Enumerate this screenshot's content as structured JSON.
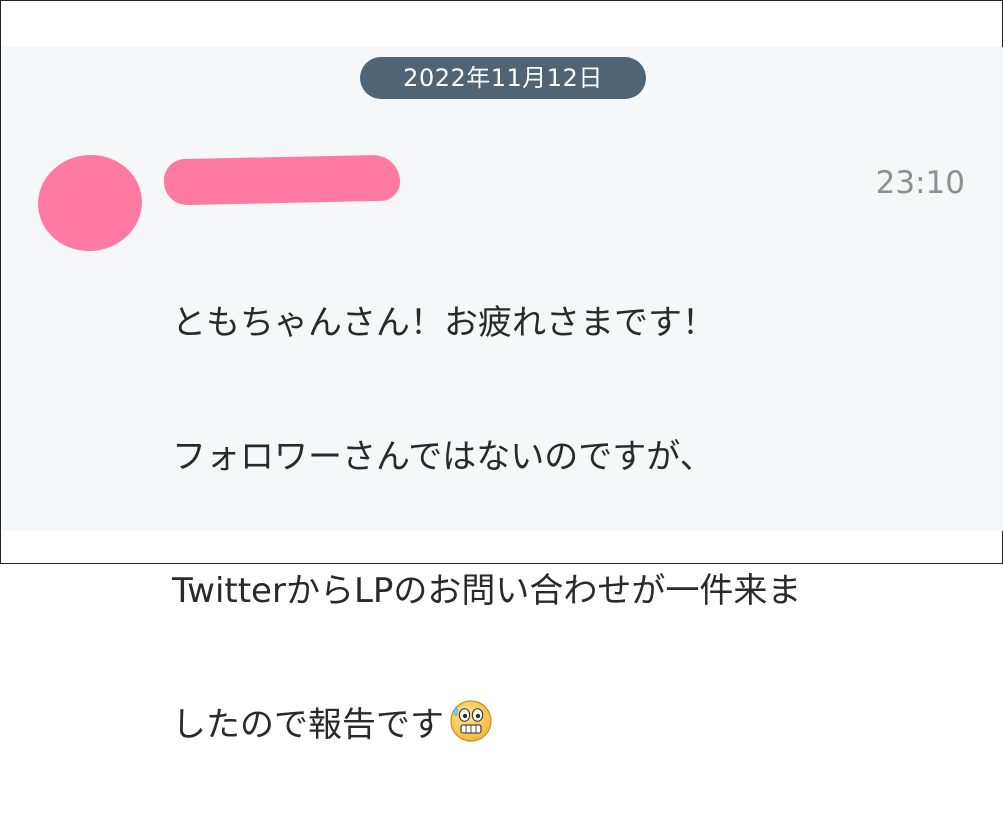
{
  "chat": {
    "date": "2022年11月12日",
    "time": "23:10",
    "message_lines": [
      "ともちゃんさん！お疲れさまです！",
      "フォロワーさんではないのですが、",
      "TwitterからLPのお問い合わせが一件来ま",
      "したので報告です"
    ],
    "emoji_icon": "grinning-sweat-face-icon"
  },
  "colors": {
    "panel_background": "#f6f7f9",
    "date_pill": "#4f6475",
    "redaction": "#ff7aa2",
    "timestamp_text": "#8f8f8f",
    "message_text": "#2a2a2a"
  }
}
